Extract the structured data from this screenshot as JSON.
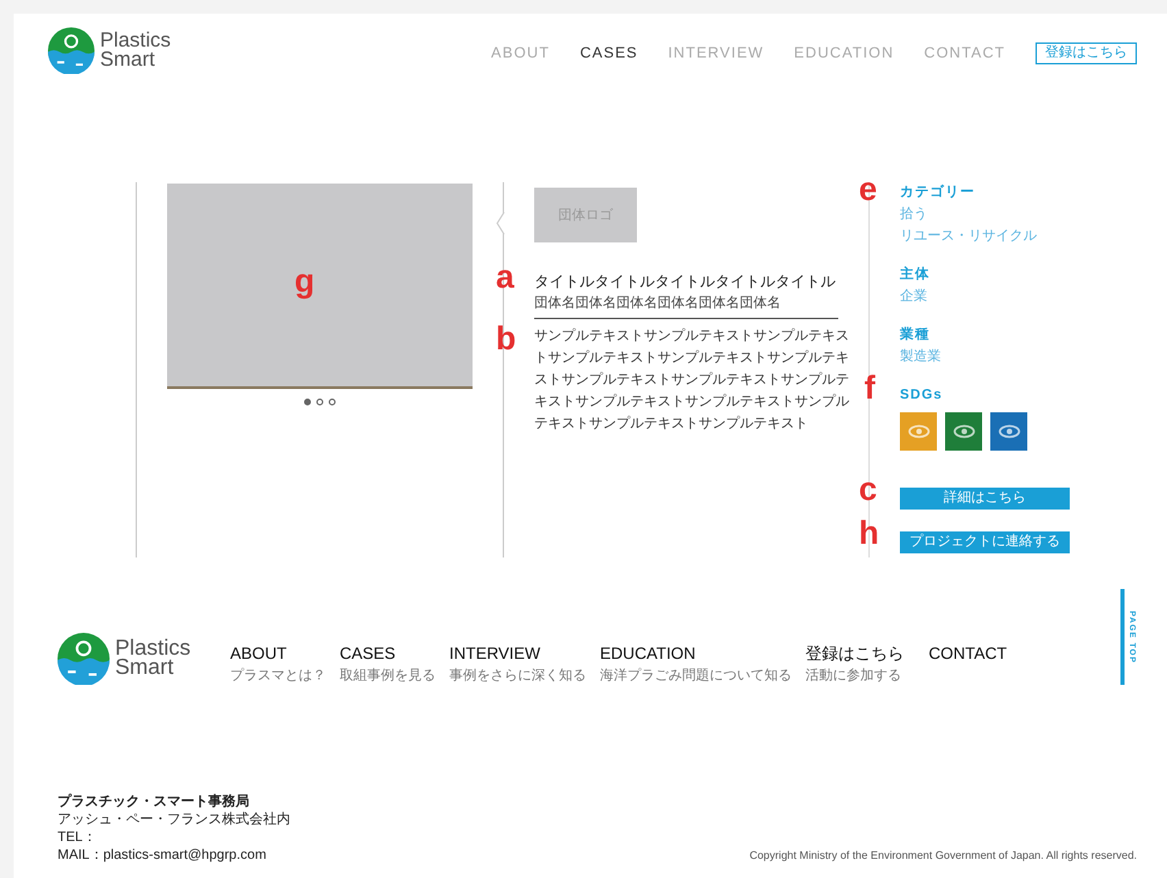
{
  "header": {
    "logo": [
      "Plastics",
      "Smart"
    ],
    "nav": [
      {
        "label": "ABOUT",
        "selected": false
      },
      {
        "label": "CASES",
        "selected": true
      },
      {
        "label": "INTERVIEW",
        "selected": false
      },
      {
        "label": "EDUCATION",
        "selected": false
      },
      {
        "label": "CONTACT",
        "selected": false
      }
    ],
    "register_button": "登録はこちら"
  },
  "case": {
    "image": {
      "marker": "g"
    },
    "carousel_dots": [
      {
        "selected": true
      },
      {
        "selected": false
      },
      {
        "selected": false
      }
    ],
    "org_logo": "団体ロゴ",
    "title": {
      "text": "タイトルタイトルタイトルタイトルタイトル",
      "marker": "a"
    },
    "org_name": "団体名団体名団体名団体名団体名団体名",
    "body": {
      "text": "サンプルテキストサンプルテキストサンプルテキストサンプルテキストサンプルテキストサンプルテキストサンプルテキストサンプルテキストサンプルテキストサンプルテキストサンプルテキストサンプルテキストサンプルテキストサンプルテキスト",
      "marker": "b"
    },
    "groups": [
      {
        "heading": "カテゴリー",
        "items": [
          "拾う",
          "リユース・リサイクル"
        ],
        "marker": "e"
      },
      {
        "heading": "主体",
        "items": [
          "企業"
        ]
      },
      {
        "heading": "業種",
        "items": [
          "製造業"
        ]
      }
    ],
    "sdgs": {
      "heading": "SDGs",
      "marker": "f",
      "icons": [
        {
          "color": "#e5a024"
        },
        {
          "color": "#1f7e3a"
        },
        {
          "color": "#1a6fb5"
        }
      ]
    },
    "buttons": [
      {
        "label": "詳細はこちら",
        "marker": "c"
      },
      {
        "label": "プロジェクトに連絡する",
        "marker": "h"
      }
    ]
  },
  "footer": {
    "logo": [
      "Plastics",
      "Smart"
    ],
    "nav": [
      {
        "label": "ABOUT",
        "sub": "プラスマとは？"
      },
      {
        "label": "CASES",
        "sub": "取組事例を見る"
      },
      {
        "label": "INTERVIEW",
        "sub": "事例をさらに深く知る"
      },
      {
        "label": "EDUCATION",
        "sub": "海洋プラごみ問題について知る"
      },
      {
        "label": "登録はこちら",
        "sub": "活動に参加する"
      },
      {
        "label": "CONTACT"
      }
    ],
    "page_top": "PAGE TOP",
    "office": [
      "プラスチック・スマート事務局",
      "アッシュ・ペー・フランス株式会社内",
      "TEL：",
      "MAIL：plastics-smart@hpgrp.com"
    ],
    "copyright": "Copyright Ministry of the Environment Government of Japan. All rights reserved."
  }
}
